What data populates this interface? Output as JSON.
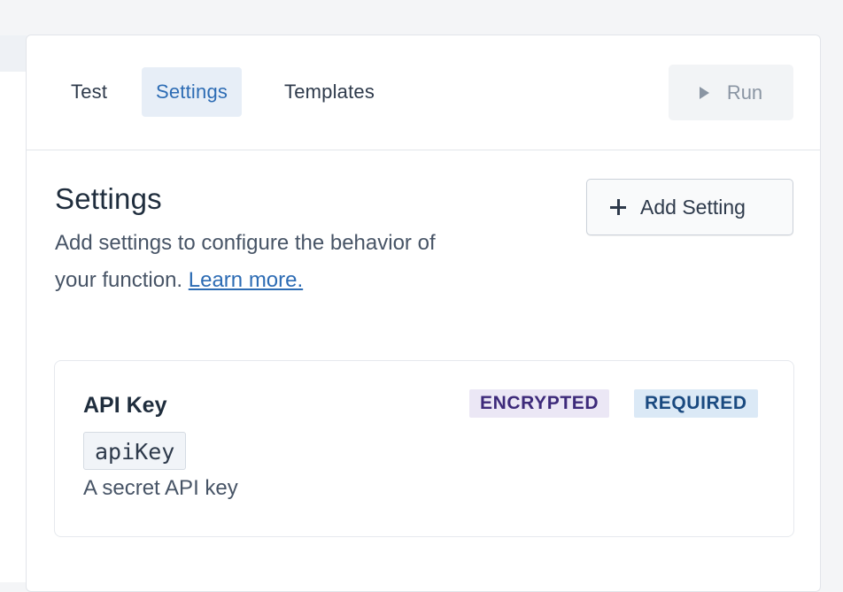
{
  "tabs": [
    {
      "label": "Test",
      "active": false
    },
    {
      "label": "Settings",
      "active": true
    },
    {
      "label": "Templates",
      "active": false
    }
  ],
  "run_button": {
    "label": "Run",
    "icon": "play-icon",
    "disabled": true
  },
  "section": {
    "title": "Settings",
    "description": "Add settings to configure the behavior of your function.",
    "learn_more": "Learn more."
  },
  "add_setting_button": {
    "label": "Add Setting",
    "icon": "plus-icon"
  },
  "settings": [
    {
      "name": "API Key",
      "key": "apiKey",
      "description": "A secret API key",
      "badges": [
        "ENCRYPTED",
        "REQUIRED"
      ]
    }
  ],
  "colors": {
    "accent": "#2d6cb4",
    "active_tab_bg": "#e7eef7",
    "encrypted_badge_bg": "#ebe7f5",
    "required_badge_bg": "#dbe9f6"
  }
}
